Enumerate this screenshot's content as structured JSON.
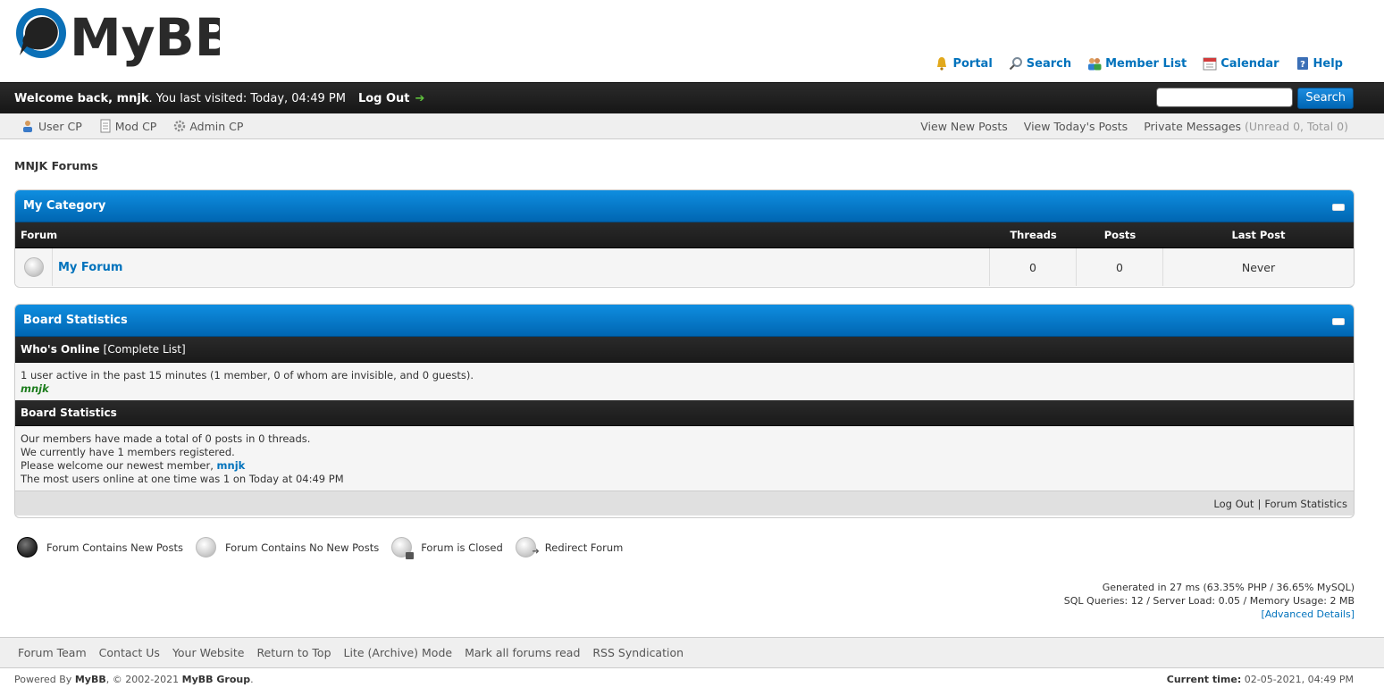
{
  "brand": {
    "logo_text": "MyBB"
  },
  "top_links": [
    {
      "label": "Portal",
      "icon": "portal-icon"
    },
    {
      "label": "Search",
      "icon": "search-icon"
    },
    {
      "label": "Member List",
      "icon": "member-list-icon"
    },
    {
      "label": "Calendar",
      "icon": "calendar-icon"
    },
    {
      "label": "Help",
      "icon": "help-icon"
    }
  ],
  "userbar": {
    "welcome_prefix": "Welcome back, ",
    "username": "mnjk",
    "last_visit": ". You last visited: Today, 04:49 PM",
    "logout_label": "Log Out",
    "search_placeholder": "",
    "search_button": "Search"
  },
  "subpanel": {
    "user_cp": "User CP",
    "mod_cp": "Mod CP",
    "admin_cp": "Admin CP",
    "view_new_posts": "View New Posts",
    "view_todays_posts": "View Today's Posts",
    "private_messages": "Private Messages",
    "pm_counts": "(Unread 0, Total 0)"
  },
  "breadcrumb": "MNJK Forums",
  "category": {
    "title": "My Category",
    "headers": {
      "forum": "Forum",
      "threads": "Threads",
      "posts": "Posts",
      "last_post": "Last Post"
    },
    "forums": [
      {
        "name": "My Forum",
        "threads": "0",
        "posts": "0",
        "last_post": "Never"
      }
    ]
  },
  "stats": {
    "title": "Board Statistics",
    "whos_online": "Who's Online",
    "complete_list": "[Complete List]",
    "online_text": "1 user active in the past 15 minutes (1 member, 0 of whom are invisible, and 0 guests).",
    "online_user": "mnjk",
    "board_stats_header": "Board Statistics",
    "line1": "Our members have made a total of 0 posts in 0 threads.",
    "line2": "We currently have 1 members registered.",
    "line3_prefix": "Please welcome our newest member, ",
    "newest_member": "mnjk",
    "line4": "The most users online at one time was 1 on Today at 04:49 PM",
    "foot_logout": "Log Out",
    "foot_sep": "|",
    "foot_forum_stats": "Forum Statistics"
  },
  "legend": {
    "new_posts": "Forum Contains New Posts",
    "no_new_posts": "Forum Contains No New Posts",
    "closed": "Forum is Closed",
    "redirect": "Redirect Forum"
  },
  "debug": {
    "line1": "Generated in 27 ms (63.35% PHP / 36.65% MySQL)",
    "line2": "SQL Queries: 12 / Server Load: 0.05 / Memory Usage: 2 MB",
    "advanced": "[Advanced Details]"
  },
  "footer": {
    "links": [
      "Forum Team",
      "Contact Us",
      "Your Website",
      "Return to Top",
      "Lite (Archive) Mode",
      "Mark all forums read",
      "RSS Syndication"
    ],
    "powered_prefix": "Powered By ",
    "powered_mybb": "MyBB",
    "powered_mid": ", © 2002-2021 ",
    "powered_group": "MyBB Group",
    "powered_end": ".",
    "current_time_label": "Current time:",
    "current_time_value": " 02-05-2021, 04:49 PM"
  },
  "colors": {
    "accent_blue": "#0072bc",
    "header_blue": "#0f8ee0",
    "dark_bar": "#1a1a1a",
    "online_green": "#1d7d1d"
  }
}
